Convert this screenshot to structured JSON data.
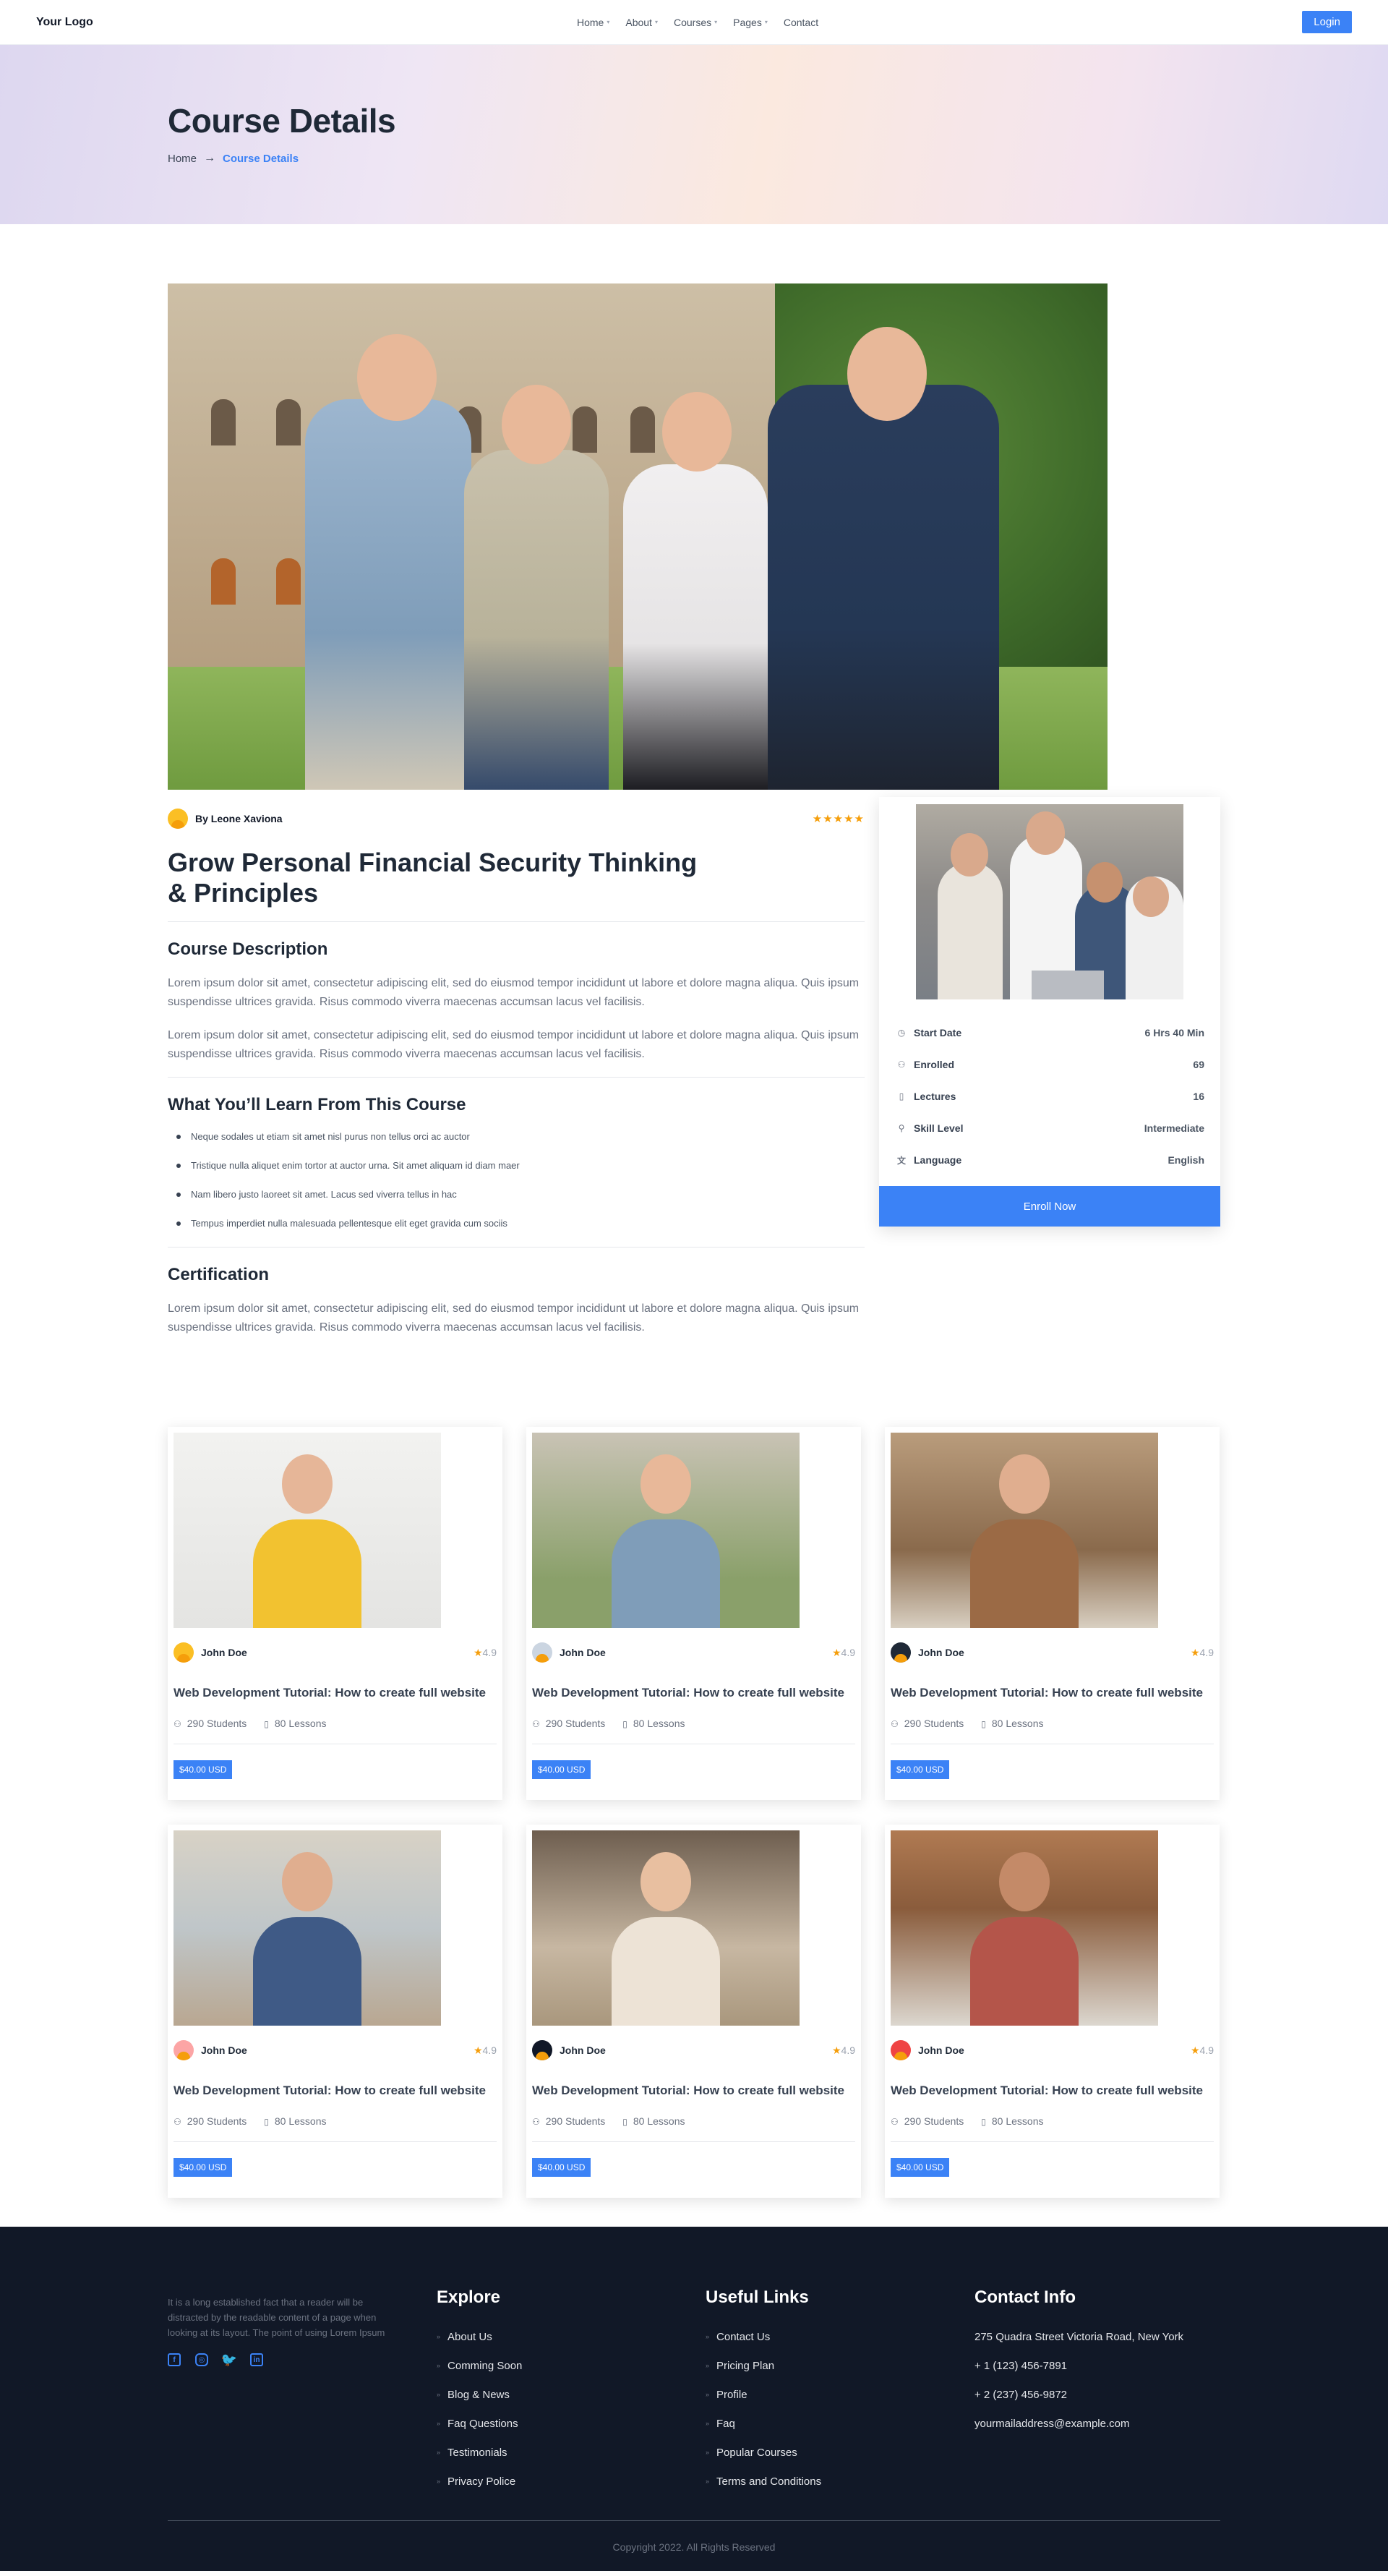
{
  "nav": {
    "logo": "Your Logo",
    "items": [
      {
        "label": "Home",
        "dropdown": true
      },
      {
        "label": "About",
        "dropdown": true
      },
      {
        "label": "Courses",
        "dropdown": true
      },
      {
        "label": "Pages",
        "dropdown": true
      },
      {
        "label": "Contact",
        "dropdown": false
      }
    ],
    "login": "Login"
  },
  "hero": {
    "title": "Course Details",
    "breadcrumb": {
      "home": "Home",
      "current": "Course Details"
    }
  },
  "course": {
    "author": "By Leone Xaviona",
    "rating_stars": "★★★★★",
    "title": "Grow Personal Financial Security Thinking & Principles",
    "description_heading": "Course Description",
    "description": [
      "Lorem ipsum dolor sit amet, consectetur adipiscing elit, sed do eiusmod tempor incididunt ut labore et dolore magna aliqua. Quis ipsum suspendisse ultrices gravida. Risus commodo viverra maecenas accumsan lacus vel facilisis.",
      "Lorem ipsum dolor sit amet, consectetur adipiscing elit, sed do eiusmod tempor incididunt ut labore et dolore magna aliqua. Quis ipsum suspendisse ultrices gravida. Risus commodo viverra maecenas accumsan lacus vel facilisis."
    ],
    "learn_heading": "What You’ll Learn From This Course",
    "learn": [
      "Neque sodales ut etiam sit amet nisl purus non tellus orci ac auctor",
      "Tristique nulla aliquet enim tortor at auctor urna. Sit amet aliquam id diam maer",
      "Nam libero justo laoreet sit amet. Lacus sed viverra tellus in hac",
      "Tempus imperdiet nulla malesuada pellentesque elit eget gravida cum sociis"
    ],
    "certification_heading": "Certification",
    "certification": "Lorem ipsum dolor sit amet, consectetur adipiscing elit, sed do eiusmod tempor incididunt ut labore et dolore magna aliqua. Quis ipsum suspendisse ultrices gravida. Risus commodo viverra maecenas accumsan lacus vel facilisis."
  },
  "sidebar": {
    "rows": [
      {
        "icon": "clock-icon",
        "label": "Start Date",
        "value": "6 Hrs 40 Min"
      },
      {
        "icon": "users-icon",
        "label": "Enrolled",
        "value": "69"
      },
      {
        "icon": "file-icon",
        "label": "Lectures",
        "value": "16"
      },
      {
        "icon": "level-icon",
        "label": "Skill Level",
        "value": "Intermediate"
      },
      {
        "icon": "language-icon",
        "label": "Language",
        "value": "English"
      }
    ],
    "enroll": "Enroll Now"
  },
  "cards": [
    {
      "author": "John Doe",
      "rating": "4.9",
      "title": "Web Development Tutorial: How to create full website",
      "students": "290 Students",
      "lessons": "80 Lessons",
      "price": "$40.00 USD"
    },
    {
      "author": "John Doe",
      "rating": "4.9",
      "title": "Web Development Tutorial: How to create full website",
      "students": "290 Students",
      "lessons": "80 Lessons",
      "price": "$40.00 USD"
    },
    {
      "author": "John Doe",
      "rating": "4.9",
      "title": "Web Development Tutorial: How to create full website",
      "students": "290 Students",
      "lessons": "80 Lessons",
      "price": "$40.00 USD"
    },
    {
      "author": "John Doe",
      "rating": "4.9",
      "title": "Web Development Tutorial: How to create full website",
      "students": "290 Students",
      "lessons": "80 Lessons",
      "price": "$40.00 USD"
    },
    {
      "author": "John Doe",
      "rating": "4.9",
      "title": "Web Development Tutorial: How to create full website",
      "students": "290 Students",
      "lessons": "80 Lessons",
      "price": "$40.00 USD"
    },
    {
      "author": "John Doe",
      "rating": "4.9",
      "title": "Web Development Tutorial: How to create full website",
      "students": "290 Students",
      "lessons": "80 Lessons",
      "price": "$40.00 USD"
    }
  ],
  "footer": {
    "about": "It is a long established fact that a reader will be distracted by the readable content of a page when looking at its layout. The point of using Lorem Ipsum",
    "explore_heading": "Explore",
    "explore": [
      "About Us",
      "Comming Soon",
      "Blog & News",
      "Faq Questions",
      "Testimonials",
      "Privacy Police"
    ],
    "useful_heading": "Useful Links",
    "useful": [
      "Contact Us",
      "Pricing Plan",
      "Profile",
      "Faq",
      "Popular Courses",
      "Terms and Conditions"
    ],
    "contact_heading": "Contact Info",
    "contact": [
      "275 Quadra Street Victoria Road, New York",
      "+ 1 (123) 456-7891",
      "+ 2 (237) 456-9872",
      "yourmailaddress@example.com"
    ],
    "copyright": "Copyright 2022. All Rights Reserved"
  },
  "colors": {
    "accent": "#3b82f6",
    "star": "#f59e0b",
    "footer_bg": "#111827"
  }
}
